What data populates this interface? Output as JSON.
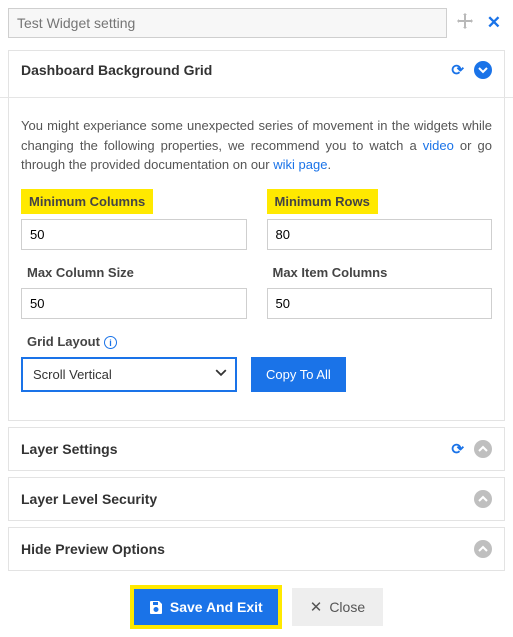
{
  "header": {
    "title_placeholder": "Test Widget setting"
  },
  "section": {
    "title": "Dashboard Background Grid",
    "help": {
      "prefix": "You might experiance some unexpected series of movement in the widgets while changing the following properties, we recommend you to watch a ",
      "video": "video",
      "middle": " or go through the provided documentation on our ",
      "wiki": "wiki page",
      "suffix": "."
    },
    "fields": {
      "min_cols_label": "Minimum Columns",
      "min_cols_value": "50",
      "max_col_size_label": "Max Column Size",
      "max_col_size_value": "50",
      "min_rows_label": "Minimum Rows",
      "min_rows_value": "80",
      "max_item_cols_label": "Max Item Columns",
      "max_item_cols_value": "50",
      "grid_layout_label": "Grid Layout",
      "grid_layout_value": "Scroll Vertical",
      "copy_label": "Copy To All"
    }
  },
  "collapsed": {
    "layer_settings": "Layer Settings",
    "layer_security": "Layer Level Security",
    "hide_preview": "Hide Preview Options"
  },
  "footer": {
    "save": "Save And Exit",
    "close": "Close"
  },
  "icons": {
    "refresh": "⟳"
  }
}
